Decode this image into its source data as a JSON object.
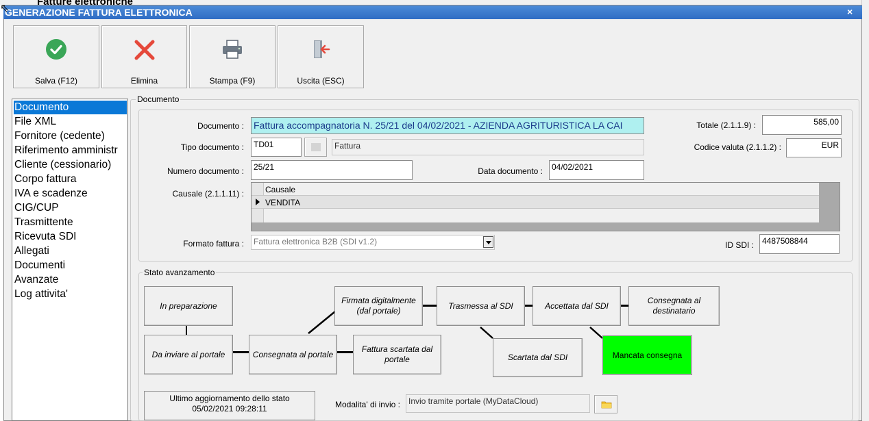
{
  "background_window": {
    "title": "Fatture elettroniche"
  },
  "window": {
    "title": "GENERAZIONE FATTURA ELETTRONICA",
    "close": "×"
  },
  "toolbar": {
    "save": "Salva (F12)",
    "delete": "Elimina",
    "print": "Stampa (F9)",
    "exit": "Uscita (ESC)"
  },
  "nav": {
    "items": [
      "Documento",
      "File XML",
      "Fornitore (cedente)",
      "Riferimento amministr",
      "Cliente (cessionario)",
      "Corpo fattura",
      "IVA e scadenze",
      "CIG/CUP",
      "Trasmittente",
      "Ricevuta SDI",
      "Allegati",
      "Documenti",
      "Avanzate",
      "Log attivita'"
    ],
    "selected": "Documento"
  },
  "documento": {
    "group_label": "Documento",
    "documento_label": "Documento :",
    "documento_value": "Fattura accompagnatoria N. 25/21 del 04/02/2021 - AZIENDA AGRITURISTICA LA CAI",
    "tipo_label": "Tipo documento :",
    "tipo_code": "TD01",
    "tipo_desc": "Fattura",
    "numero_label": "Numero documento :",
    "numero_value": "25/21",
    "data_label": "Data documento :",
    "data_value": "04/02/2021",
    "totale_label": "Totale (2.1.1.9) :",
    "totale_value": "585,00",
    "valuta_label": "Codice valuta (2.1.1.2) :",
    "valuta_value": "EUR",
    "causale_label": "Causale (2.1.1.11) :",
    "causale_header": "Causale",
    "causale_rows": [
      "VENDITA"
    ],
    "formato_label": "Formato fattura :",
    "formato_value": "Fattura elettronica B2B (SDI v1.2)",
    "idsdi_label": "ID SDI :",
    "idsdi_value": "4487508844"
  },
  "stato": {
    "group_label": "Stato avanzamento",
    "states": {
      "in_preparazione": "In preparazione",
      "da_inviare": "Da inviare al portale",
      "consegnata_portale": "Consegnata al portale",
      "firmata": "Firmata digitalmente (dal portale)",
      "scartata_portale": "Fattura scartata dal portale",
      "trasmessa": "Trasmessa al SDI",
      "scartata_sdi": "Scartata dal SDI",
      "accettata": "Accettata dal SDI",
      "mancata": "Mancata consegna",
      "consegnata_dest": "Consegnata al destinatario"
    },
    "active_state_color": "#00ff00",
    "last_update_label": "Ultimo aggiornamento dello stato",
    "last_update_value": "05/02/2021 09:28:11",
    "modalita_label": "Modalita' di invio :",
    "modalita_value": "Invio tramite portale (MyDataCloud)"
  },
  "icons": {
    "save": "check-circle-icon",
    "delete": "red-x-icon",
    "print": "printer-icon",
    "exit": "exit-door-icon",
    "folder": "folder-icon"
  },
  "colors": {
    "titlebar": "#2f6cc4",
    "nav_selected": "#0a78d7",
    "documento_field": "#aff0f0",
    "save_icon": "#3aa657",
    "delete_icon": "#e5483a"
  }
}
